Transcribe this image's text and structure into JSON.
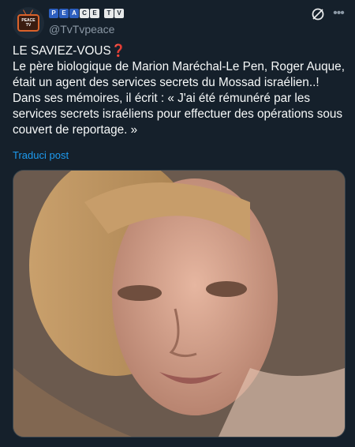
{
  "account": {
    "avatar_text": "PEACE\nTV",
    "badges": [
      "P",
      "E",
      "A",
      "C",
      "E",
      "",
      "T",
      "V"
    ],
    "handle": "@TvTvpeace"
  },
  "post": {
    "text": "LE SAVIEZ-VOUS❓\nLe père biologique de Marion Maréchal-Le Pen, Roger Auque, était un agent des services secrets du Mossad israélien..! Dans ses mémoires, il écrit : « J'ai été rémunéré par les services secrets israéliens pour effectuer des opérations sous couvert de reportage. »",
    "translate_label": "Traduci post"
  },
  "icons": {
    "grok": "grok-icon",
    "more": "more-icon"
  },
  "colors": {
    "background": "#15202b",
    "text": "#f7f9f9",
    "secondary": "#8b98a5",
    "link": "#1d9bf0"
  }
}
